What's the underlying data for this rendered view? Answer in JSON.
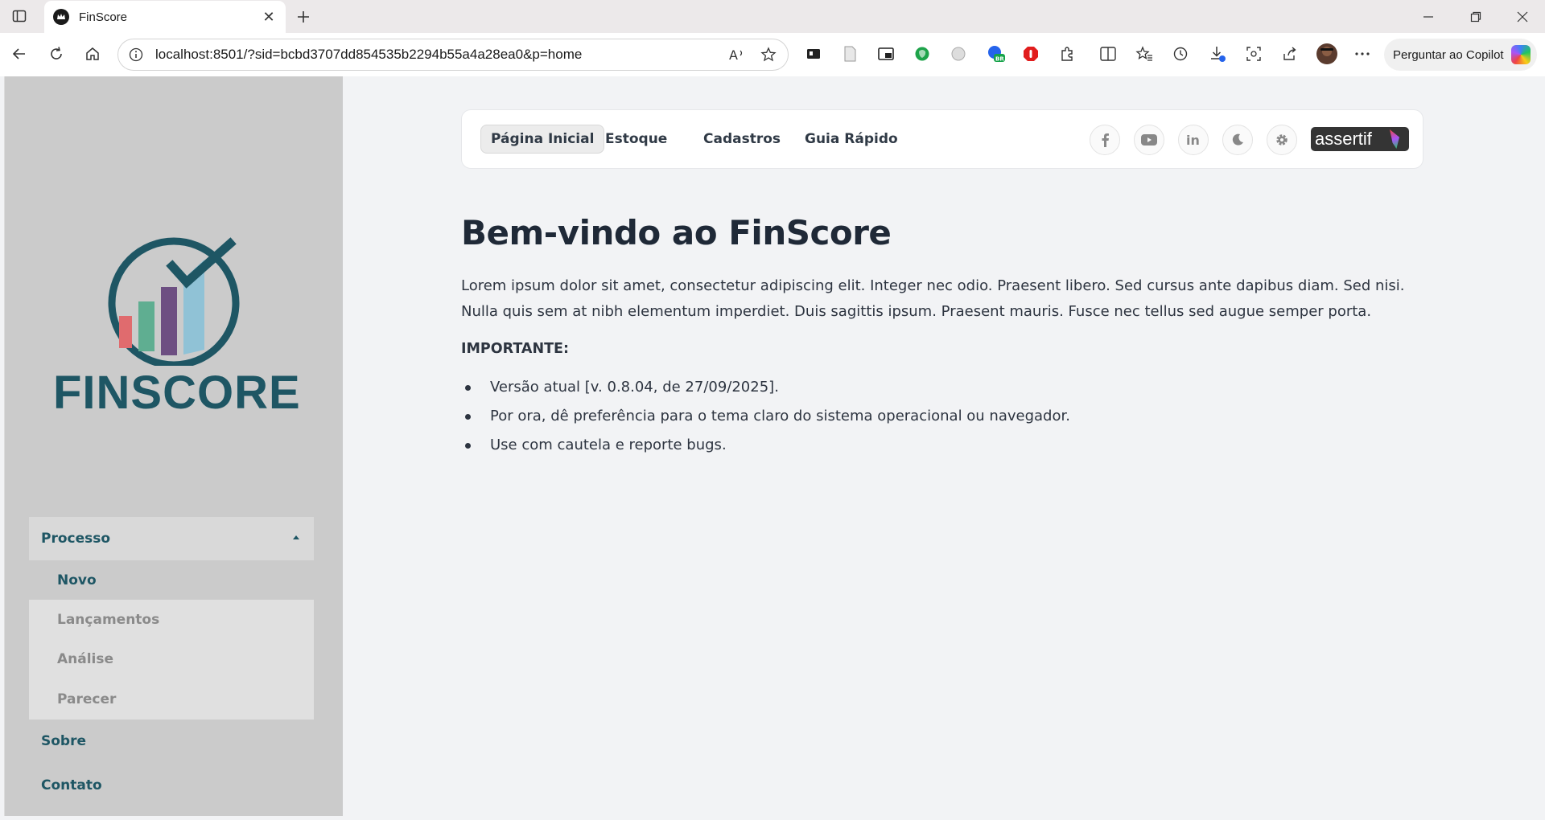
{
  "browser": {
    "tab_title": "FinScore",
    "url": "localhost:8501/?sid=bcbd3707dd854535b2294b55a4a28ea0&p=home",
    "copilot_label": "Perguntar ao Copilot"
  },
  "sidebar": {
    "logo_text": "FINSCORE",
    "menu": {
      "group_label": "Processo",
      "active_item": "Novo",
      "sub_items": [
        "Lançamentos",
        "Análise",
        "Parecer"
      ],
      "items": [
        "Sobre",
        "Contato"
      ]
    }
  },
  "navbar": {
    "links": [
      "Página Inicial",
      "Estoque",
      "Cadastros",
      "Guia Rápido"
    ],
    "active_index": 0,
    "icons": [
      "facebook-icon",
      "youtube-icon",
      "linkedin-icon",
      "moon-icon",
      "gear-icon"
    ],
    "brand": "assertif"
  },
  "main": {
    "title": "Bem-vindo ao FinScore",
    "intro": "Lorem ipsum dolor sit amet, consectetur adipiscing elit. Integer nec odio. Praesent libero. Sed cursus ante dapibus diam. Sed nisi. Nulla quis sem at nibh elementum imperdiet. Duis sagittis ipsum. Praesent mauris. Fusce nec tellus sed augue semper porta.",
    "important_label": "IMPORTANTE:",
    "bullets": [
      "Versão atual [v. 0.8.04, de 27/09/2025].",
      "Por ora, dê preferência para o tema claro do sistema operacional ou navegador.",
      "Use com cautela e reporte bugs."
    ]
  },
  "colors": {
    "sidebar_bg": "#cbcbcb",
    "brand_teal": "#1e5664",
    "page_bg": "#f2f3f5"
  }
}
